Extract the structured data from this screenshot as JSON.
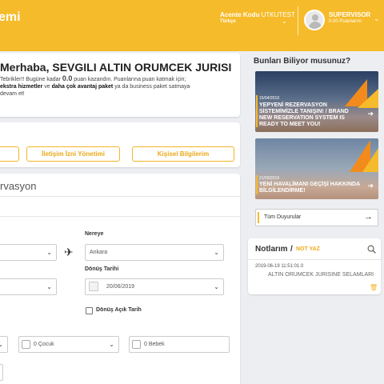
{
  "header": {
    "brand_partial": "emi",
    "agency_label": "Acente Kodu",
    "agency_code": "UTKUTEST",
    "language": "Türkçe",
    "user_name": "SUPERVISOR",
    "user_points": "0.00 Puanlarım"
  },
  "welcome": {
    "title": "Merhaba, SEVGILI ALTIN ORUMCEK JURISI",
    "line1_a": "Tebrikler!! Bugüne kadar ",
    "line1_points": "0.0",
    "line1_b": " puan kazandın. Puanlarına puan katmak için;",
    "line2_a": "ekstra hizmetler",
    "line2_b": " ve ",
    "line2_c": "daha çok avantaj paket",
    "line2_d": " ya da business paket satmaya",
    "line3": "devam et!"
  },
  "profile": {
    "buttons": [
      "İletişim İzni Yönetimi",
      "Kişisel Bilgilerim"
    ]
  },
  "booking": {
    "title_partial": "rvasyon",
    "to_label": "Nereye",
    "to_value": "Ankara",
    "return_label": "Dönüş Tarihi",
    "return_value": "20/06/2019",
    "open_return_label": "Dönüş Açık Tarih",
    "child_value": "0 Çocuk",
    "infant_value": "0 Bebek"
  },
  "news": {
    "title": "Bunları Biliyor musunuz?",
    "items": [
      {
        "date": "15/04/2019",
        "text": "YEPYENİ REZERVASYON SİSTEMİMİZLE TANIŞIN! / BRAND NEW RESERVATION SYSTEM IS READY TO MEET YOU!"
      },
      {
        "date": "21/03/2019",
        "text": "YENİ HAVALİMANI GEÇİŞİ HAKKINDA BİLGİLENDİRME!"
      }
    ],
    "all_label": "Tüm Duyurular"
  },
  "notes": {
    "title": "Notlarım",
    "separator": "/",
    "write_label": "NOT YAZ",
    "items": [
      {
        "date": "2019-06-19 11:51:01.0",
        "text": "ALTIN ORUMCEK JURISINE SELAMLARI"
      }
    ]
  },
  "colors": {
    "accent": "#f6bb2a",
    "accent_text": "#e9a818",
    "tail_orange": "#f28b1c"
  }
}
